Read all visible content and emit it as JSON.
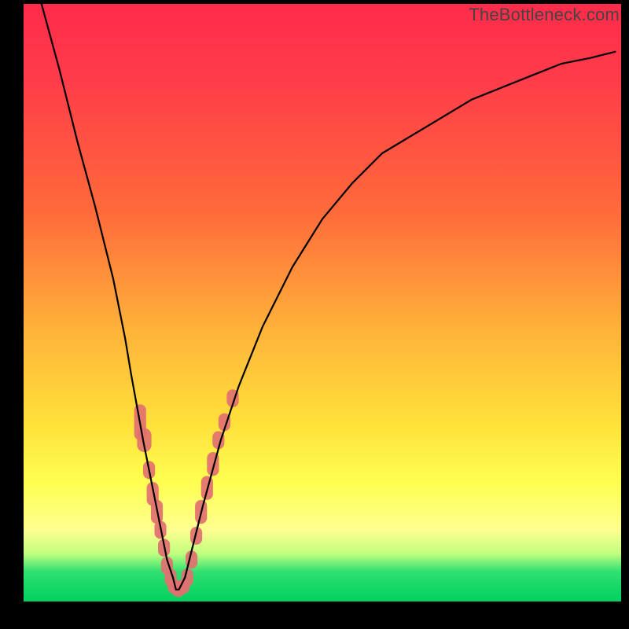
{
  "watermark": "TheBottleneck.com",
  "chart_data": {
    "type": "line",
    "title": "",
    "xlabel": "",
    "ylabel": "",
    "xlim": [
      0,
      100
    ],
    "ylim": [
      0,
      100
    ],
    "grid": false,
    "legend": false,
    "series": [
      {
        "name": "bottleneck-curve",
        "x": [
          3,
          6,
          9,
          12,
          15,
          17,
          18,
          20,
          22,
          23,
          24,
          25,
          25.5,
          26,
          27,
          28,
          30,
          33,
          36,
          40,
          45,
          50,
          55,
          60,
          65,
          70,
          75,
          80,
          85,
          90,
          95,
          99
        ],
        "y": [
          100,
          89,
          77,
          66,
          54,
          44,
          38,
          27,
          17,
          12,
          7,
          4,
          2,
          2,
          4,
          8,
          16,
          27,
          36,
          46,
          56,
          64,
          70,
          75,
          78,
          81,
          84,
          86,
          88,
          90,
          91,
          92
        ]
      }
    ],
    "markers": {
      "name": "highlighted-points",
      "color": "#e27070",
      "shape": "rounded-rect",
      "points": [
        {
          "x": 19.5,
          "y": 30,
          "w": 2.0,
          "h": 6
        },
        {
          "x": 20.2,
          "y": 27,
          "w": 2.4,
          "h": 4
        },
        {
          "x": 21.0,
          "y": 22,
          "w": 2.0,
          "h": 3
        },
        {
          "x": 21.6,
          "y": 18,
          "w": 2.0,
          "h": 4
        },
        {
          "x": 22.3,
          "y": 15,
          "w": 2.0,
          "h": 4
        },
        {
          "x": 22.9,
          "y": 12,
          "w": 2.0,
          "h": 3
        },
        {
          "x": 23.5,
          "y": 9,
          "w": 2.0,
          "h": 3
        },
        {
          "x": 24.0,
          "y": 6,
          "w": 2.0,
          "h": 3
        },
        {
          "x": 24.6,
          "y": 4,
          "w": 2.0,
          "h": 3
        },
        {
          "x": 25.2,
          "y": 2.5,
          "w": 2.2,
          "h": 2.5
        },
        {
          "x": 25.9,
          "y": 2.0,
          "w": 2.4,
          "h": 2.5
        },
        {
          "x": 26.7,
          "y": 2.5,
          "w": 2.2,
          "h": 2.5
        },
        {
          "x": 27.4,
          "y": 4,
          "w": 2.0,
          "h": 3
        },
        {
          "x": 28.1,
          "y": 7,
          "w": 2.0,
          "h": 3
        },
        {
          "x": 28.9,
          "y": 11,
          "w": 2.0,
          "h": 3
        },
        {
          "x": 29.7,
          "y": 15,
          "w": 2.0,
          "h": 4
        },
        {
          "x": 30.7,
          "y": 19,
          "w": 2.0,
          "h": 4
        },
        {
          "x": 31.7,
          "y": 23,
          "w": 2.0,
          "h": 4
        },
        {
          "x": 32.6,
          "y": 27,
          "w": 2.0,
          "h": 3
        },
        {
          "x": 33.6,
          "y": 30,
          "w": 2.0,
          "h": 3
        },
        {
          "x": 35.0,
          "y": 34,
          "w": 2.0,
          "h": 3
        }
      ]
    },
    "background_gradient": {
      "stops": [
        {
          "pos": 0,
          "color": "#ff2b4a"
        },
        {
          "pos": 35,
          "color": "#ff6b3a"
        },
        {
          "pos": 70,
          "color": "#ffe03a"
        },
        {
          "pos": 88,
          "color": "#ffff90"
        },
        {
          "pos": 100,
          "color": "#00d060"
        }
      ]
    }
  }
}
